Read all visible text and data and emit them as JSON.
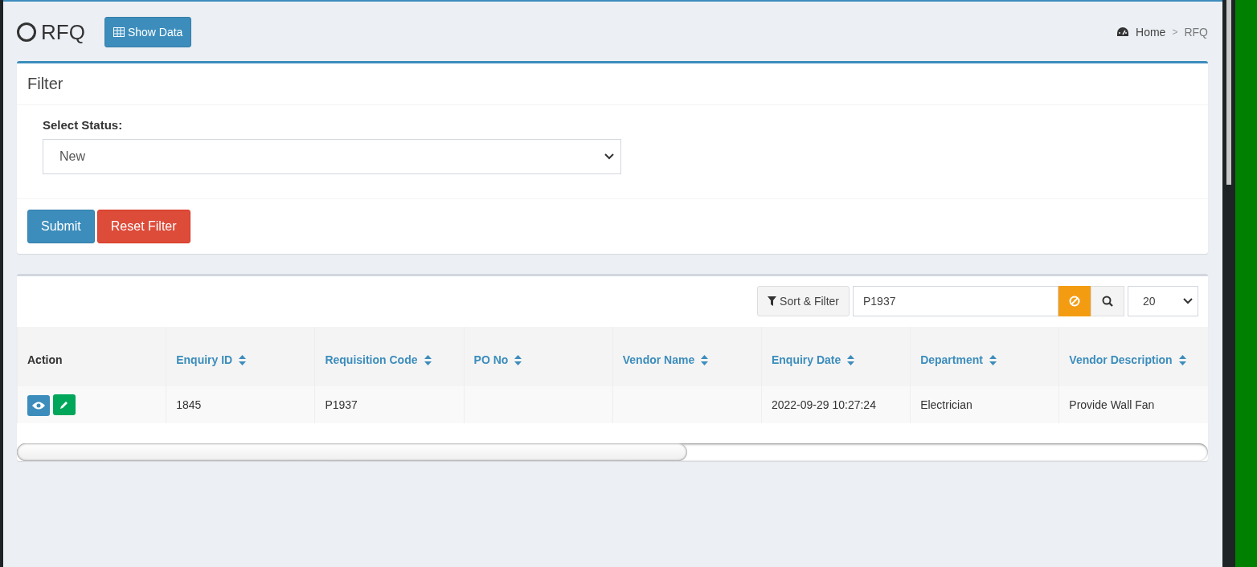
{
  "header": {
    "title": "RFQ",
    "show_data_button": "Show Data",
    "breadcrumb": [
      {
        "label": "Home",
        "kind": "link"
      },
      {
        "label": "RFQ",
        "kind": "current"
      }
    ],
    "breadcrumb_separator": ">"
  },
  "filter": {
    "title": "Filter",
    "status_label": "Select Status:",
    "status_value": "New",
    "buttons": [
      {
        "label": "Submit",
        "kind": "primary"
      },
      {
        "label": "Reset Filter",
        "kind": "danger"
      }
    ]
  },
  "toolbar": {
    "sort_filter_button": "Sort & Filter",
    "search_value": "P1937",
    "page_size": "20"
  },
  "table": {
    "columns": [
      {
        "label": "Action",
        "sortable": false
      },
      {
        "label": "Enquiry ID",
        "sortable": true
      },
      {
        "label": "Requisition Code",
        "sortable": true
      },
      {
        "label": "PO No",
        "sortable": true
      },
      {
        "label": "Vendor Name",
        "sortable": true
      },
      {
        "label": "Enquiry Date",
        "sortable": true
      },
      {
        "label": "Department",
        "sortable": true
      },
      {
        "label": "Vendor Description",
        "sortable": true
      }
    ],
    "rows": [
      {
        "cells": [
          "",
          "1845",
          "P1937",
          "",
          "",
          "2022-09-29 10:27:24",
          "Electrician",
          "Provide Wall Fan"
        ]
      }
    ]
  }
}
